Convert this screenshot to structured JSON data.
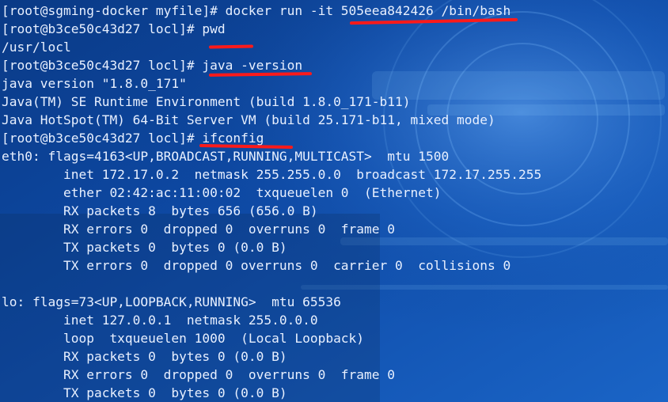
{
  "terminal": {
    "lines": [
      "[root@sgming-docker myfile]# docker run -it 505eea842426 /bin/bash",
      "[root@b3ce50c43d27 locl]# pwd",
      "/usr/locl",
      "[root@b3ce50c43d27 locl]# java -version",
      "java version \"1.8.0_171\"",
      "Java(TM) SE Runtime Environment (build 1.8.0_171-b11)",
      "Java HotSpot(TM) 64-Bit Server VM (build 25.171-b11, mixed mode)",
      "[root@b3ce50c43d27 locl]# ifconfig",
      "eth0: flags=4163<UP,BROADCAST,RUNNING,MULTICAST>  mtu 1500",
      "        inet 172.17.0.2  netmask 255.255.0.0  broadcast 172.17.255.255",
      "        ether 02:42:ac:11:00:02  txqueuelen 0  (Ethernet)",
      "        RX packets 8  bytes 656 (656.0 B)",
      "        RX errors 0  dropped 0  overruns 0  frame 0",
      "        TX packets 0  bytes 0 (0.0 B)",
      "        TX errors 0  dropped 0 overruns 0  carrier 0  collisions 0",
      "",
      "lo: flags=73<UP,LOOPBACK,RUNNING>  mtu 65536",
      "        inet 127.0.0.1  netmask 255.0.0.0",
      "        loop  txqueuelen 1000  (Local Loopback)",
      "        RX packets 0  bytes 0 (0.0 B)",
      "        RX errors 0  dropped 0  overruns 0  frame 0",
      "        TX packets 0  bytes 0 (0.0 B)"
    ]
  },
  "colors": {
    "text": "#e8f0ff",
    "underline": "#ff1a1a",
    "background_dark": "#07306f",
    "background_light": "#2c7fd6"
  }
}
